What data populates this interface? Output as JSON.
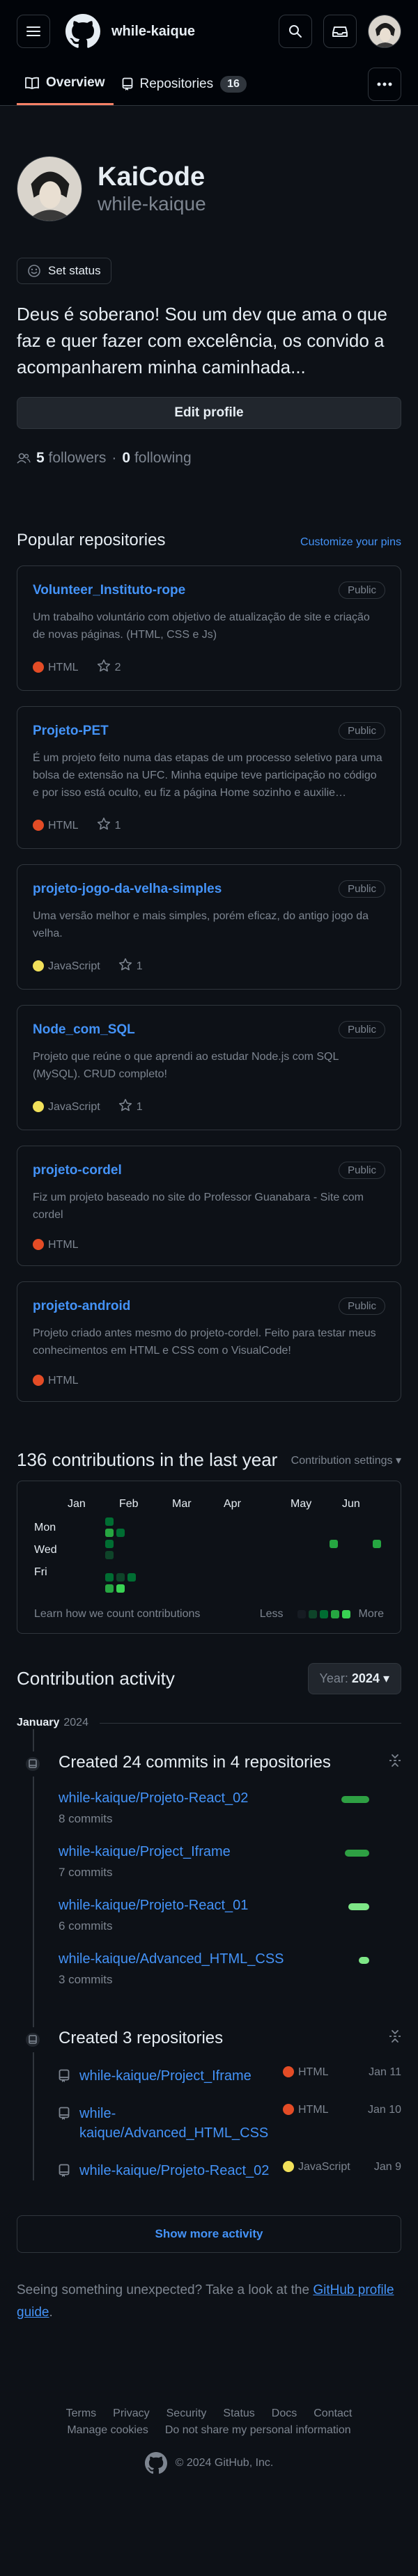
{
  "header": {
    "username": "while-kaique"
  },
  "tabs": [
    {
      "label": "Overview"
    },
    {
      "label": "Repositories",
      "count": "16"
    }
  ],
  "profile": {
    "name": "KaiCode",
    "login": "while-kaique",
    "set_status": "Set status",
    "bio": "Deus é soberano! Sou um dev que ama o que faz e quer fazer com excelência, os convido a acompanharem minha caminhada...",
    "edit_profile": "Edit profile",
    "followers_count": "5",
    "followers_label": "followers",
    "sep": "·",
    "following_count": "0",
    "following_label": "following"
  },
  "popular": {
    "title": "Popular repositories",
    "customize": "Customize your pins",
    "repos": [
      {
        "name": "Volunteer_Instituto-rope",
        "visibility": "Public",
        "desc": "Um trabalho voluntário com objetivo de atualização de site e criação de novas páginas. (HTML, CSS e Js)",
        "lang": "HTML",
        "lang_color": "#e34c26",
        "stars": "2"
      },
      {
        "name": "Projeto-PET",
        "visibility": "Public",
        "desc": "É um projeto feito numa das etapas de um processo seletivo para uma bolsa de extensão na UFC. Minha equipe teve participação no código e por isso está oculto, eu fiz a página Home sozinho e auxilie…",
        "lang": "HTML",
        "lang_color": "#e34c26",
        "stars": "1"
      },
      {
        "name": "projeto-jogo-da-velha-simples",
        "visibility": "Public",
        "desc": "Uma versão melhor e mais simples, porém eficaz, do antigo jogo da velha.",
        "lang": "JavaScript",
        "lang_color": "#f1e05a",
        "stars": "1"
      },
      {
        "name": "Node_com_SQL",
        "visibility": "Public",
        "desc": "Projeto que reúne o que aprendi ao estudar Node.js com SQL (MySQL). CRUD completo!",
        "lang": "JavaScript",
        "lang_color": "#f1e05a",
        "stars": "1"
      },
      {
        "name": "projeto-cordel",
        "visibility": "Public",
        "desc": "Fiz um projeto baseado no site do Professor Guanabara - Site com cordel",
        "lang": "HTML",
        "lang_color": "#e34c26",
        "stars": ""
      },
      {
        "name": "projeto-android",
        "visibility": "Public",
        "desc": "Projeto criado antes mesmo do projeto-cordel. Feito para testar meus conhecimentos em HTML e CSS com o VisualCode!",
        "lang": "HTML",
        "lang_color": "#e34c26",
        "stars": ""
      }
    ]
  },
  "contributions": {
    "title": "136 contributions in the last year",
    "settings": "Contribution settings",
    "months": [
      "Jan",
      "Feb",
      "Mar",
      "Apr",
      "May",
      "Jun"
    ],
    "days": [
      "Mon",
      "Wed",
      "Fri"
    ],
    "learn": "Learn how we count contributions",
    "less": "Less",
    "more": "More",
    "colors": {
      "empty": "#161b22",
      "l1": "#0e4429",
      "l2": "#006d32",
      "l3": "#26a641",
      "l4": "#39d353"
    }
  },
  "activity": {
    "title": "Contribution activity",
    "year_label": "Year:",
    "year": "2024",
    "month": "January",
    "month_year": "2024",
    "commits_title": "Created 24 commits in 4 repositories",
    "commits": [
      {
        "repo": "while-kaique/Projeto-React_02",
        "count": "8 commits",
        "pct": 1.0
      },
      {
        "repo": "while-kaique/Project_Iframe",
        "count": "7 commits",
        "pct": 0.875
      },
      {
        "repo": "while-kaique/Projeto-React_01",
        "count": "6 commits",
        "pct": 0.75
      },
      {
        "repo": "while-kaique/Advanced_HTML_CSS",
        "count": "3 commits",
        "pct": 0.375
      }
    ],
    "repos_title": "Created 3 repositories",
    "new_repos": [
      {
        "repo": "while-kaique/Project_Iframe",
        "lang": "HTML",
        "lang_color": "#e34c26",
        "date": "Jan 11"
      },
      {
        "repo": "while-kaique/Advanced_HTML_CSS",
        "lang": "HTML",
        "lang_color": "#e34c26",
        "date": "Jan 10"
      },
      {
        "repo": "while-kaique/Projeto-React_02",
        "lang": "JavaScript",
        "lang_color": "#f1e05a",
        "date": "Jan 9"
      }
    ],
    "show_more": "Show more activity"
  },
  "unexpected": {
    "text": "Seeing something unexpected? Take a look at the ",
    "link": "GitHub profile guide",
    "end": "."
  },
  "footer": {
    "links": [
      "Terms",
      "Privacy",
      "Security",
      "Status",
      "Docs",
      "Contact",
      "Manage cookies",
      "Do not share my personal information"
    ],
    "copyright": "© 2024 GitHub, Inc."
  },
  "icons": {
    "menu": "hamburger-icon",
    "logo": "github-logo",
    "search": "search-icon",
    "inbox": "inbox-icon",
    "book": "book-icon",
    "repo": "repo-icon",
    "kebab": "kebab-horizontal-icon",
    "smiley": "smiley-icon",
    "people": "people-icon",
    "star": "star-icon",
    "commit": "repo-push-icon",
    "fold": "fold-icon",
    "caret": "triangle-down-icon"
  }
}
